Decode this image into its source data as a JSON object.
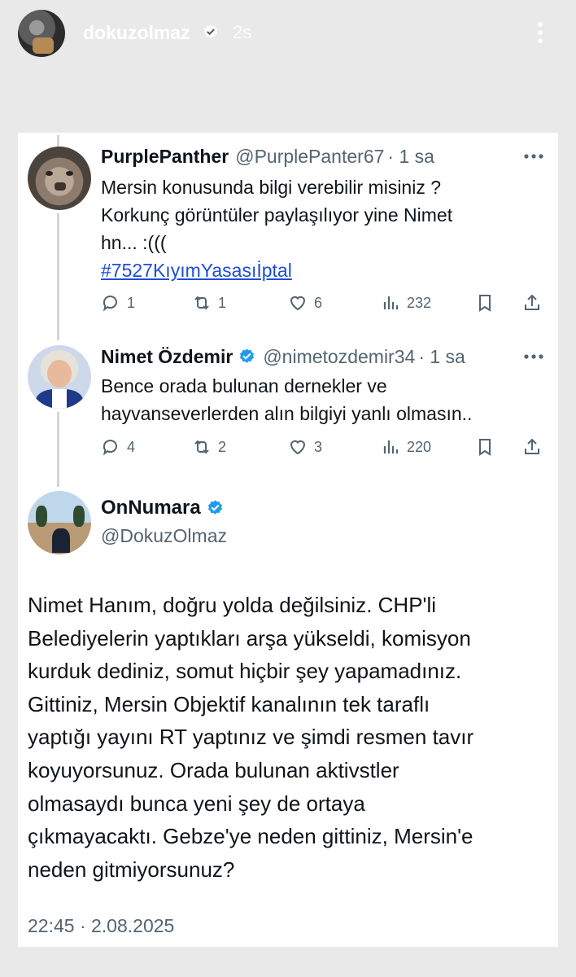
{
  "story": {
    "username": "dokuzolmaz",
    "time": "2s"
  },
  "tweets": [
    {
      "display_name": "PurplePanther",
      "handle": "@PurplePanter67",
      "time": "· 1 sa",
      "text_lines": [
        "Mersin konusunda bilgi verebilir misiniz ?",
        "Korkunç görüntüler paylaşılıyor yine Nimet",
        "hn... :((("
      ],
      "hashtag": "#7527KıyımYasasıİptal",
      "replies": "1",
      "retweets": "1",
      "likes": "6",
      "views": "232"
    },
    {
      "display_name": "Nimet Özdemir",
      "handle": "@nimetozdemir34",
      "time": "· 1 sa",
      "text_lines": [
        "Bence orada bulunan dernekler ve",
        "hayvanseverlerden alın bilgiyi yanlı olmasın.."
      ],
      "replies": "4",
      "retweets": "2",
      "likes": "3",
      "views": "220"
    }
  ],
  "main_tweet": {
    "display_name": "OnNumara",
    "handle": "@DokuzOlmaz",
    "text_lines": [
      "Nimet Hanım, doğru yolda değilsiniz. CHP'li",
      "Belediyelerin yaptıkları arşa yükseldi, komisyon",
      "kurduk dediniz, somut hiçbir şey yapamadınız.",
      "Gittiniz, Mersin Objektif kanalının tek taraflı",
      "yaptığı yayını RT yaptınız ve şimdi resmen tavır",
      "koyuyorsunuz. Orada bulunan aktivstler",
      "olmasaydı bunca yeni şey de ortaya",
      "çıkmayacaktı. Gebze'ye neden gittiniz, Mersin'e",
      "neden gitmiyorsunuz?"
    ],
    "timestamp": "22:45 · 2.08.2025"
  },
  "colors": {
    "verified": "#1d9bf0",
    "hashtag": "#1d4ed8",
    "secondary_text": "#536471",
    "story_background": "#e9e9e9"
  }
}
